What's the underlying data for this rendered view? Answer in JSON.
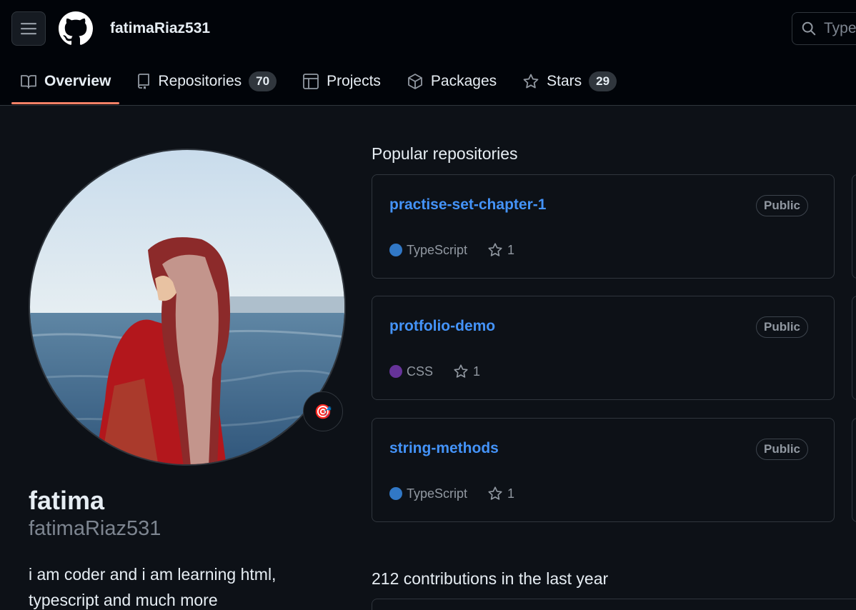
{
  "header": {
    "username": "fatimaRiaz531",
    "search_placeholder": "Type"
  },
  "tabs": [
    {
      "label": "Overview",
      "icon": "book-icon",
      "active": true
    },
    {
      "label": "Repositories",
      "icon": "repo-icon",
      "count": "70"
    },
    {
      "label": "Projects",
      "icon": "table-icon"
    },
    {
      "label": "Packages",
      "icon": "package-icon"
    },
    {
      "label": "Stars",
      "icon": "star-icon",
      "count": "29"
    }
  ],
  "profile": {
    "name": "fatima",
    "login": "fatimaRiaz531",
    "bio": "i am coder and i am learning html, typescript and much more",
    "status_emoji": "🎯"
  },
  "popular": {
    "title": "Popular repositories",
    "repos": [
      {
        "name": "practise-set-chapter-1",
        "visibility": "Public",
        "language": "TypeScript",
        "language_color": "#3178c6",
        "stars": "1"
      },
      {
        "name": "protfolio-demo",
        "visibility": "Public",
        "language": "CSS",
        "language_color": "#663399",
        "stars": "1"
      },
      {
        "name": "string-methods",
        "visibility": "Public",
        "language": "TypeScript",
        "language_color": "#3178c6",
        "stars": "1"
      }
    ]
  },
  "contributions": {
    "title": "212 contributions in the last year"
  },
  "colors": {
    "background": "#0d1117",
    "header_bg": "#010409",
    "link": "#4493f8",
    "active_tab_underline": "#f78166"
  }
}
